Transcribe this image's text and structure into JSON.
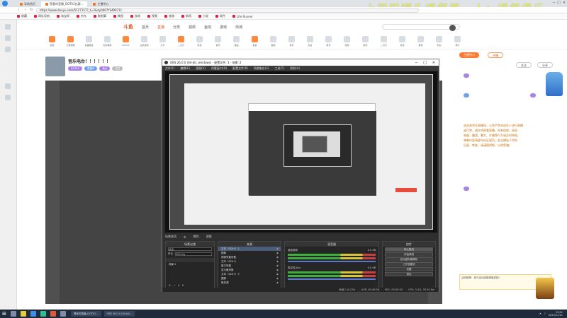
{
  "browser": {
    "tabs": [
      {
        "label": "导航首页"
      },
      {
        "label": "黑客的直播_DOTA2比赛..."
      },
      {
        "label": "主播中心"
      }
    ],
    "url": "https://www.douyu.com/5127157?_t=2&dy0007Y&fB0711",
    "bookmarks": [
      "收藏",
      "网址导航",
      "淘宝网",
      "京东",
      "聚划算",
      "携程",
      "游戏",
      "视频",
      "旅游",
      "新闻",
      "小说",
      "软件",
      "Life Runner"
    ],
    "overlay_title": "上周猫罐头提督第一人：提督俱乐"
  },
  "site": {
    "logo": "斗鱼",
    "nav": [
      "首页",
      "直播",
      "分类",
      "视频",
      "鱼吧",
      "游戏",
      "商城"
    ],
    "categories": [
      "颜值",
      "王者荣耀",
      "英雄联盟",
      "和平精英",
      "DOTA2",
      "主机游戏",
      "户外",
      "二次元",
      "科技",
      "音乐",
      "舞蹈",
      "美食",
      "数码",
      "体育",
      "综合",
      "教育",
      "游戏",
      "娱乐",
      "二次元",
      "科技",
      "星秀",
      "知识",
      "排行"
    ],
    "room": {
      "title": "音乐电台！！！！！！",
      "tags": [
        "DOTA2",
        "直播中",
        "鱼丸",
        "关注"
      ]
    },
    "sidebar": {
      "buttons": [
        "主播中心",
        "开播",
        "关注",
        "分享"
      ],
      "chat_lines": [
        "欢迎来到本直播间，斗鱼严禁未成年人进行直播",
        "或打赏，请文明观看直播，如有违规、低俗、",
        "吸烟、酗酒、暴力、诈骗等行为请及时举报。",
        "弹幕内容请遵守社区规范。若主播私下约你",
        "见面、转账，请谨慎判断，以防受骗。"
      ],
      "promo": "活动推荐：参与活动赢取超值奖励！"
    }
  },
  "obs": {
    "title": "OBS 26.0.0 (64-bit, windows) - 配置文件: 1 - 场景: 2",
    "menu": [
      "文件(F)",
      "编辑(E)",
      "视图(V)",
      "停靠窗口(D)",
      "配置文件(P)",
      "场景集合(S)",
      "工具(T)",
      "帮助(H)"
    ],
    "scene_bar": [
      "场景选项",
      "属性",
      "滤镜"
    ],
    "panels": {
      "scenes": "场景过渡",
      "sources": "来源",
      "mixer": "混音器",
      "controls": "控件"
    },
    "transition": {
      "label": "淡出",
      "duration_label": "时长",
      "duration": "300 ms"
    },
    "scene_list_item": "场景 2",
    "sources": [
      "文本（GDI+）2",
      "图像",
      "视频采集设备",
      "文本（GDI+）",
      "窗口采集",
      "显示器采集",
      "文本（GDI+）3",
      "图像",
      "媒体源"
    ],
    "mixer": [
      {
        "name": "桌面音频",
        "db": "0.0 dB"
      },
      {
        "name": "麦克风/Aux",
        "db": "0.0 dB"
      }
    ],
    "controls": [
      "停止推流",
      "开始录制",
      "启动虚拟摄像机",
      "工作室模式",
      "设置",
      "退出"
    ],
    "status": {
      "dropped": "丢帧 0 (0.0%)",
      "live": "LIVE: 00:49:38",
      "rec": "REC: 00:00:00",
      "cpu": "CPU: 3.4%, 30.00 fps"
    }
  },
  "taskbar": {
    "tasks": [
      "黑客的直播_DOTA2...",
      "OBS 26.0.0 (64-bit..."
    ],
    "time": "19:01",
    "date": "2020/11/11"
  }
}
